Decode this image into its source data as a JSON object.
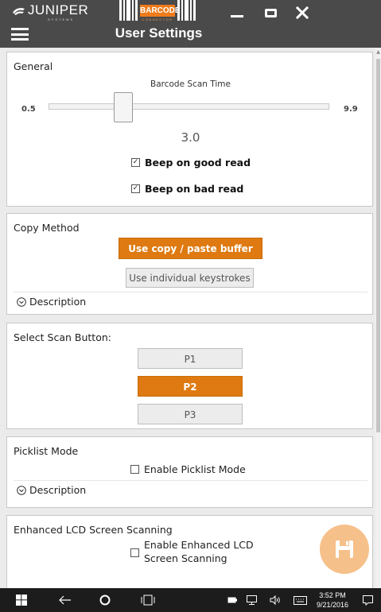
{
  "window": {
    "brand_name": "JUNIPER",
    "brand_sub": "SYSTEMS",
    "logo_text": "BARCODE",
    "logo_sub": "CONNECTOR",
    "page_title": "User Settings"
  },
  "general": {
    "title": "General",
    "slider_label": "Barcode Scan Time",
    "slider_min": "0.5",
    "slider_max": "9.9",
    "slider_value": "3.0",
    "beep_good_label": "Beep on good read",
    "beep_good_checked": true,
    "beep_bad_label": "Beep on bad read",
    "beep_bad_checked": true
  },
  "copy_method": {
    "title": "Copy Method",
    "option_paste": "Use copy / paste buffer",
    "option_keys": "Use individual keystrokes",
    "selected": "Use copy / paste buffer",
    "description": "Description"
  },
  "scan_button": {
    "title": "Select Scan Button:",
    "options": [
      "P1",
      "P2",
      "P3"
    ],
    "selected": "P2"
  },
  "picklist": {
    "title": "Picklist Mode",
    "checkbox_label": "Enable Picklist Mode",
    "checked": false,
    "description": "Description"
  },
  "lcd": {
    "title": "Enhanced LCD Screen Scanning",
    "checkbox_label": "Enable Enhanced LCD Screen Scanning",
    "checked": false
  },
  "taskbar": {
    "time": "3:52 PM",
    "date": "9/21/2016"
  },
  "colors": {
    "accent": "#de7a11",
    "titlebar": "#4a4a4a",
    "fab": "#f6c08a",
    "taskbar": "#1c1c1c"
  },
  "icons": {
    "brand": "juniper-logo-icon",
    "menu": "hamburger-icon",
    "fab": "save-floppy-icon",
    "start": "windows-start-icon"
  }
}
